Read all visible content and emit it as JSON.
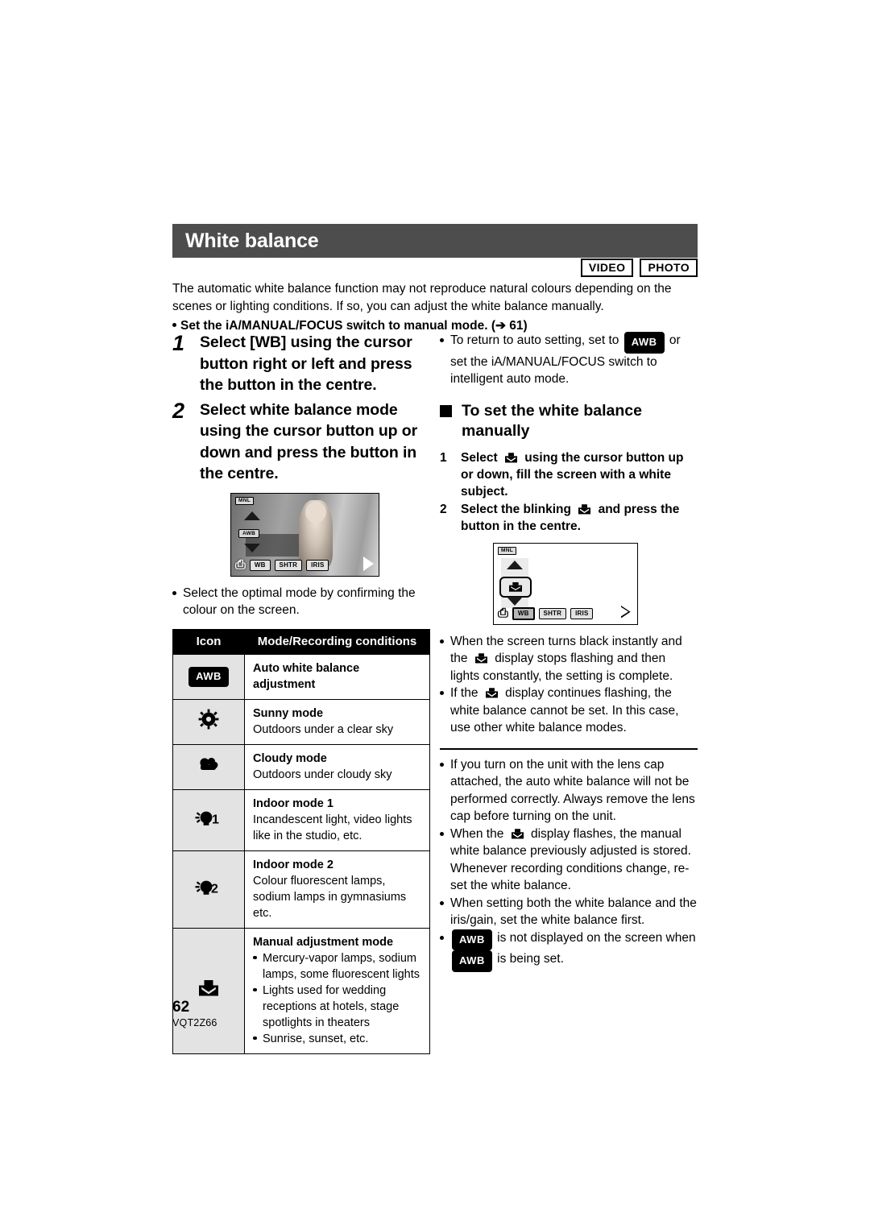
{
  "header": {
    "title": "White balance",
    "badges": [
      "VIDEO",
      "PHOTO"
    ]
  },
  "intro": {
    "paragraph": "The automatic white balance function may not reproduce natural colours depending on the scenes or lighting conditions. If so, you can adjust the white balance manually.",
    "bullet_bold": "Set the iA/MANUAL/FOCUS switch to manual mode.",
    "bullet_ref": "(➔ 61)"
  },
  "left": {
    "steps": [
      {
        "num": "1",
        "text": "Select [WB] using the cursor button right or left and press the button in the centre."
      },
      {
        "num": "2",
        "text": "Select white balance mode using the cursor button up or down and press the button in the centre."
      }
    ],
    "screen": {
      "mnl_label": "MNL",
      "awb_label": "AWB",
      "buttons": [
        "WB",
        "SHTR",
        "IRIS"
      ]
    },
    "note": "Select the optimal mode by confirming the colour on the screen.",
    "table": {
      "headers": [
        "Icon",
        "Mode/Recording conditions"
      ],
      "rows": [
        {
          "icon": "awb-chip-icon",
          "icon_label": "AWB",
          "name": "Auto white balance adjustment",
          "desc": "",
          "bullets": []
        },
        {
          "icon": "sun-icon",
          "icon_label": "",
          "name": "Sunny mode",
          "desc": "Outdoors under a clear sky",
          "bullets": []
        },
        {
          "icon": "cloud-icon",
          "icon_label": "",
          "name": "Cloudy mode",
          "desc": "Outdoors under cloudy sky",
          "bullets": []
        },
        {
          "icon": "indoor-1-icon",
          "icon_label": "1",
          "name": "Indoor mode 1",
          "desc": "Incandescent light, video lights like in the studio, etc.",
          "bullets": []
        },
        {
          "icon": "indoor-2-icon",
          "icon_label": "2",
          "name": "Indoor mode 2",
          "desc": "Colour fluorescent lamps, sodium lamps in gymnasiums etc.",
          "bullets": []
        },
        {
          "icon": "manual-wb-icon",
          "icon_label": "",
          "name": "Manual adjustment mode",
          "desc": "",
          "bullets": [
            "Mercury-vapor lamps, sodium lamps, some fluorescent lights",
            "Lights used for wedding receptions at hotels, stage spotlights in theaters",
            "Sunrise, sunset, etc."
          ]
        }
      ]
    }
  },
  "right": {
    "auto_note_a": "To return to auto setting, set to",
    "auto_note_chip": "AWB",
    "auto_note_b": "or set the iA/MANUAL/FOCUS switch to intelligent auto mode.",
    "subhead": "To set the white balance manually",
    "steps": [
      {
        "num": "1",
        "a": "Select",
        "b": "using the cursor button up or down, fill the screen with a white subject."
      },
      {
        "num": "2",
        "a": "Select the blinking",
        "b": "and press the button in the centre."
      }
    ],
    "screen": {
      "mnl_label": "MNL",
      "buttons": [
        "WB",
        "SHTR",
        "IRIS"
      ]
    },
    "notes_upper": [
      {
        "a": "When the screen turns black instantly and the",
        "b": "display stops flashing and then lights constantly, the setting is complete."
      },
      {
        "a": "If the",
        "b": "display continues flashing, the white balance cannot be set. In this case, use other white balance modes."
      }
    ],
    "notes_lower": [
      {
        "a": "If you turn on the unit with the lens cap attached, the auto white balance will not be performed correctly. Always remove the lens cap before turning on the unit.",
        "b": ""
      },
      {
        "a": "When the",
        "b": "display flashes, the manual white balance previously adjusted is stored. Whenever recording conditions change, re-set the white balance."
      },
      {
        "a": "When setting both the white balance and the iris/gain, set the white balance first.",
        "b": ""
      }
    ],
    "note_awb_a": "is not displayed on the screen when",
    "note_awb_b": "is being set.",
    "chip_label": "AWB"
  },
  "footer": {
    "page_number": "62",
    "doc_code": "VQT2Z66"
  },
  "colors": {
    "band": "#4d4d4d",
    "icon_cell": "#e3e3e3",
    "text": "#000000"
  }
}
